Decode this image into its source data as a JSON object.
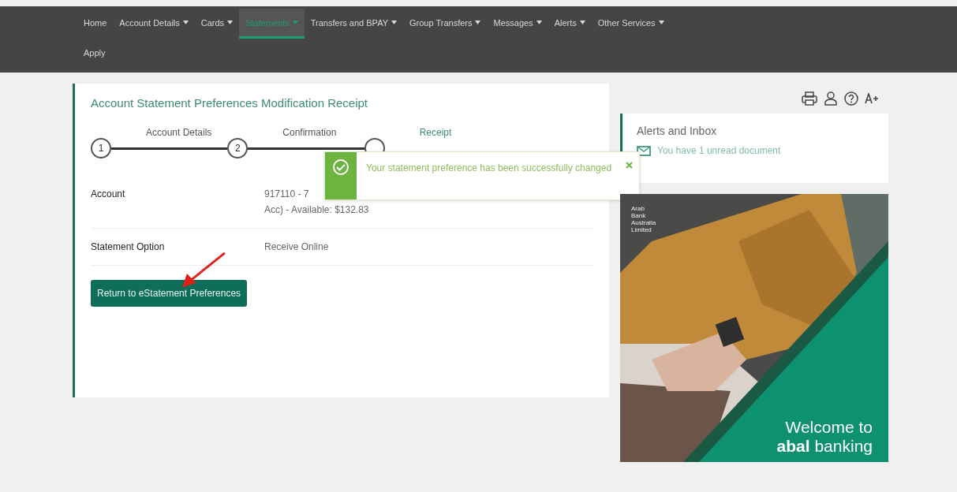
{
  "nav": {
    "items": [
      {
        "label": "Home",
        "has_menu": false,
        "selected": false
      },
      {
        "label": "Account Details",
        "has_menu": true,
        "selected": false
      },
      {
        "label": "Cards",
        "has_menu": true,
        "selected": false
      },
      {
        "label": "Statements",
        "has_menu": true,
        "selected": true
      },
      {
        "label": "Transfers and BPAY",
        "has_menu": true,
        "selected": false
      },
      {
        "label": "Group Transfers",
        "has_menu": true,
        "selected": false
      },
      {
        "label": "Messages",
        "has_menu": true,
        "selected": false
      },
      {
        "label": "Alerts",
        "has_menu": true,
        "selected": false
      },
      {
        "label": "Other Services",
        "has_menu": true,
        "selected": false
      },
      {
        "label": "Apply",
        "has_menu": false,
        "selected": false
      }
    ]
  },
  "receipt": {
    "title": "Account Statement Preferences Modification Receipt",
    "steps": [
      {
        "number": "1",
        "label": "Account Details"
      },
      {
        "number": "2",
        "label": "Confirmation"
      },
      {
        "label": "Receipt"
      }
    ],
    "fields": [
      {
        "label": "Account",
        "values": [
          "917110 - 7",
          "Acc) - Available: $132.83"
        ]
      },
      {
        "label": "Statement Option",
        "values": [
          "Receive Online"
        ]
      }
    ],
    "button": "Return to eStatement Preferences"
  },
  "toast": {
    "message": "Your statement preference has been successfully changed"
  },
  "alerts": {
    "title": "Alerts and Inbox",
    "message": "You have 1 unread document"
  },
  "banner": {
    "brand": [
      "Arab",
      "Bank",
      "Australia",
      "Limited"
    ],
    "headline": "Welcome to",
    "bold": "abal",
    "tail": "banking"
  }
}
